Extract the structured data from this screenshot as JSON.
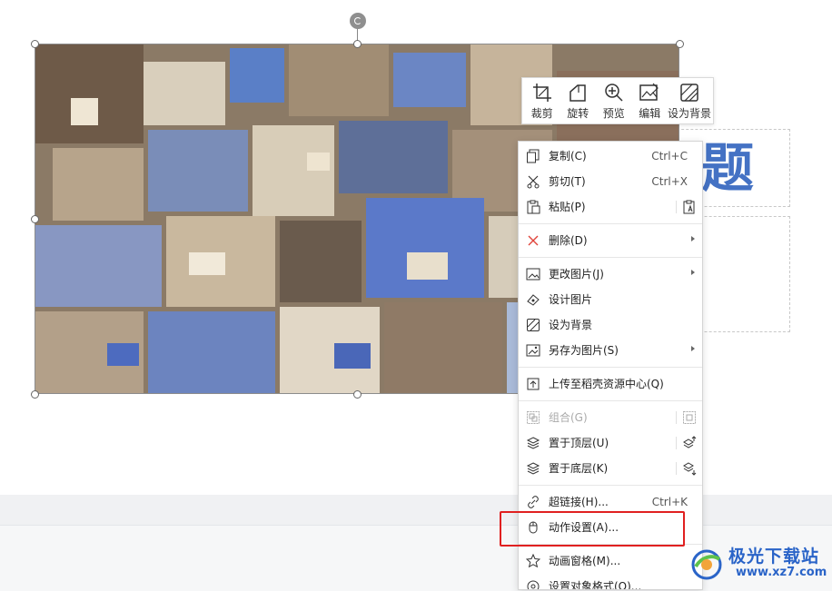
{
  "slide": {
    "title_char": "题"
  },
  "toolbar": {
    "items": [
      {
        "label": "裁剪",
        "icon": "crop-icon"
      },
      {
        "label": "旋转",
        "icon": "rotate-icon"
      },
      {
        "label": "预览",
        "icon": "zoom-preview-icon"
      },
      {
        "label": "编辑",
        "icon": "edit-image-icon"
      },
      {
        "label": "设为背景",
        "icon": "set-background-icon"
      }
    ]
  },
  "menu": {
    "copy": {
      "label": "复制(C)",
      "shortcut": "Ctrl+C"
    },
    "cut": {
      "label": "剪切(T)",
      "shortcut": "Ctrl+X"
    },
    "paste": {
      "label": "粘贴(P)"
    },
    "delete": {
      "label": "删除(D)"
    },
    "change_picture": {
      "label": "更改图片(J)"
    },
    "design_picture": {
      "label": "设计图片"
    },
    "set_background": {
      "label": "设为背景"
    },
    "save_as_picture": {
      "label": "另存为图片(S)"
    },
    "upload": {
      "label": "上传至稻壳资源中心(Q)"
    },
    "group": {
      "label": "组合(G)"
    },
    "bring_front": {
      "label": "置于顶层(U)"
    },
    "send_back": {
      "label": "置于底层(K)"
    },
    "hyperlink": {
      "label": "超链接(H)...",
      "shortcut": "Ctrl+K"
    },
    "action_settings": {
      "label": "动作设置(A)..."
    },
    "animation_pane": {
      "label": "动画窗格(M)..."
    },
    "format_object": {
      "label": "设置对象格式(O)..."
    }
  },
  "watermark": {
    "name": "极光下载站",
    "url": "www.xz7.com"
  },
  "colors": {
    "accent_title": "#4472c4",
    "highlight_box": "#e02020",
    "watermark": "#2a64c8"
  }
}
